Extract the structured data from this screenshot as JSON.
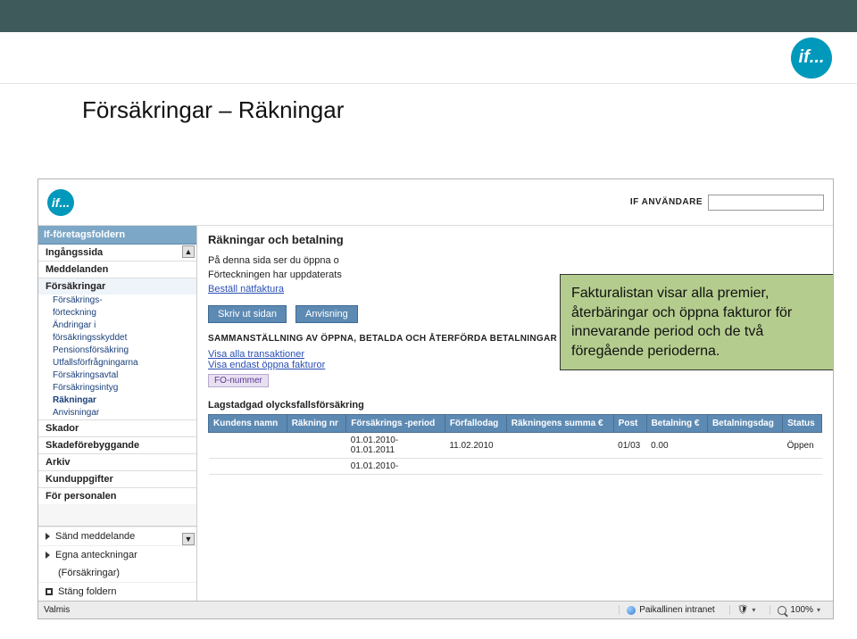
{
  "page": {
    "title": "Försäkringar – Räkningar"
  },
  "logo_text": "if...",
  "app": {
    "user_label": "IF ANVÄNDARE"
  },
  "tooltip": "Fakturalistan visar alla premier, återbäringar och öppna fakturor för innevarande period och de två föregående perioderna.",
  "sidebar": {
    "header": "If-företagsfoldern",
    "items": [
      {
        "label": "Ingångssida"
      },
      {
        "label": "Meddelanden"
      },
      {
        "label": "Försäkringar",
        "expanded": true,
        "children": [
          "Försäkrings-",
          "förteckning",
          "Ändringar i",
          "försäkringsskyddet",
          "Pensionsförsäkring",
          "Utfallsförfrågningarna",
          "Försäkringsavtal",
          "Försäkringsintyg",
          "Räkningar",
          "Anvisningar"
        ]
      },
      {
        "label": "Skador"
      },
      {
        "label": "Skadeförebyggande"
      },
      {
        "label": "Arkiv"
      },
      {
        "label": "Kunduppgifter"
      },
      {
        "label": "För personalen"
      }
    ],
    "bottom": [
      "Sänd meddelande",
      "Egna anteckningar",
      "(Försäkringar)",
      "Stäng foldern"
    ]
  },
  "main": {
    "heading": "Räkningar och betalning",
    "intro1": "På denna sida ser du öppna o",
    "intro2": "Förteckningen har uppdaterats",
    "order_link": "Beställ nätfaktura",
    "btn_print": "Skriv ut sidan",
    "btn_help": "Anvisning",
    "summary_title": "SAMMANSTÄLLNING AV ÖPPNA, BETALDA OCH ÅTERFÖRDA BETALNINGAR",
    "link_all": "Visa alla transaktioner",
    "link_open": "Visa endast öppna fakturor",
    "chip": "FO-nummer",
    "group_heading": "Lagstadgad olycksfallsförsäkring"
  },
  "table": {
    "headers": [
      "Kundens namn",
      "Räkning nr",
      "Försäkrings -period",
      "Förfallodag",
      "Räkningens summa €",
      "Post",
      "Betalning €",
      "Betalningsdag",
      "Status"
    ],
    "rows": [
      {
        "period": "01.01.2010-\n01.01.2011",
        "due": "11.02.2010",
        "post": "01/03",
        "paid": "0.00",
        "status": "Öppen"
      },
      {
        "period": "01.01.2010-",
        "due": "",
        "post": "",
        "paid": "",
        "status": ""
      }
    ]
  },
  "statusbar": {
    "ready": "Valmis",
    "zone": "Paikallinen intranet",
    "zoom": "100%"
  }
}
